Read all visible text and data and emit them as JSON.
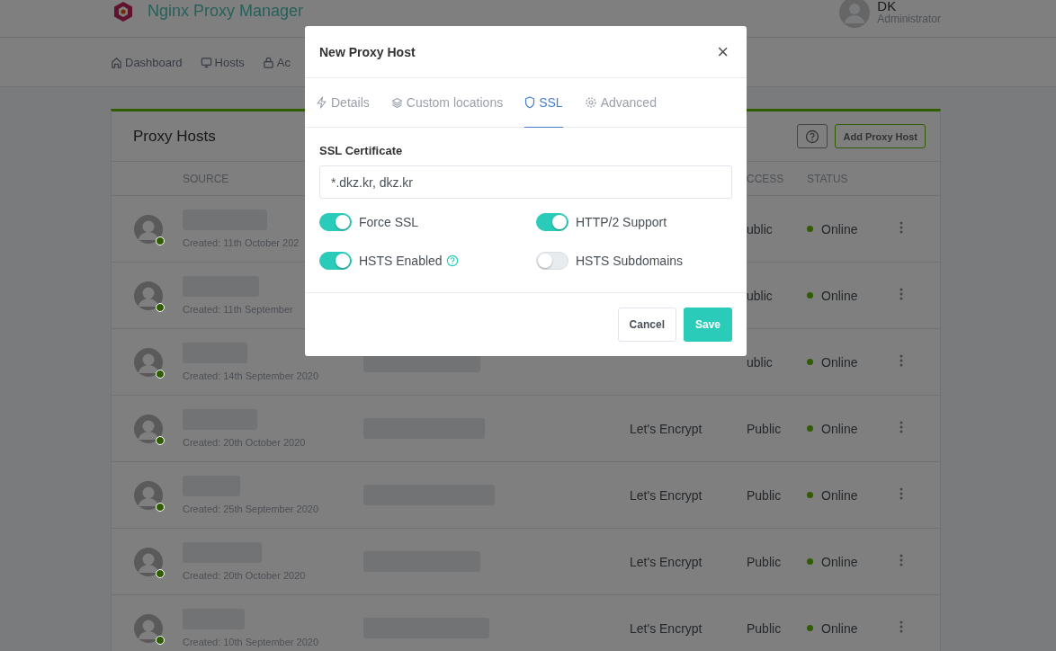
{
  "header": {
    "app_title": "Nginx Proxy Manager",
    "user": {
      "name": "DK",
      "role": "Administrator"
    }
  },
  "nav": [
    {
      "label": "Dashboard",
      "selected": false
    },
    {
      "label": "Hosts",
      "selected": false
    },
    {
      "label": "Ac",
      "selected": false
    }
  ],
  "card": {
    "title": "Proxy Hosts",
    "add_button": "Add Proxy Host",
    "columns": [
      "SOURCE",
      "CCESS",
      "STATUS"
    ],
    "rows": [
      {
        "created": "Created: 11th October 202",
        "access": "ublic",
        "status": "Online",
        "color": "#2f5d00"
      },
      {
        "created": "Created: 11th September",
        "access": "ublic",
        "status": "Online",
        "color": "#2f5d00"
      },
      {
        "created": "Created: 14th September 2020",
        "access": "ublic",
        "status": "Online",
        "color": "#2f5d00"
      },
      {
        "created": "Created: 20th October 2020",
        "ssl": "Let's Encrypt",
        "access": "Public",
        "status": "Online",
        "color": "#2f5d00"
      },
      {
        "created": "Created: 25th September 2020",
        "ssl": "Let's Encrypt",
        "access": "Public",
        "status": "Online",
        "color": "#2f5d00"
      },
      {
        "created": "Created: 20th October 2020",
        "ssl": "Let's Encrypt",
        "access": "Public",
        "status": "Online",
        "color": "#2f5d00"
      },
      {
        "created": "Created: 10th September 2020",
        "ssl": "Let's Encrypt",
        "access": "Public",
        "status": "Online",
        "color": "#2f5d00"
      }
    ]
  },
  "modal": {
    "title": "New Proxy Host",
    "close": "×",
    "tabs": [
      {
        "label": "Details",
        "selected": false
      },
      {
        "label": "Custom locations",
        "selected": false
      },
      {
        "label": "SSL",
        "selected": true
      },
      {
        "label": "Advanced",
        "selected": false
      }
    ],
    "certificate_label": "SSL Certificate",
    "certificate_value": "*.dkz.kr, dkz.kr",
    "toggles": [
      {
        "label": "Force SSL",
        "on": true
      },
      {
        "label": "HTTP/2 Support",
        "on": true
      },
      {
        "label": "HSTS Enabled",
        "on": true,
        "help": true
      },
      {
        "label": "HSTS Subdomains",
        "on": false
      }
    ],
    "buttons": {
      "cancel": "Cancel",
      "save": "Save"
    }
  }
}
